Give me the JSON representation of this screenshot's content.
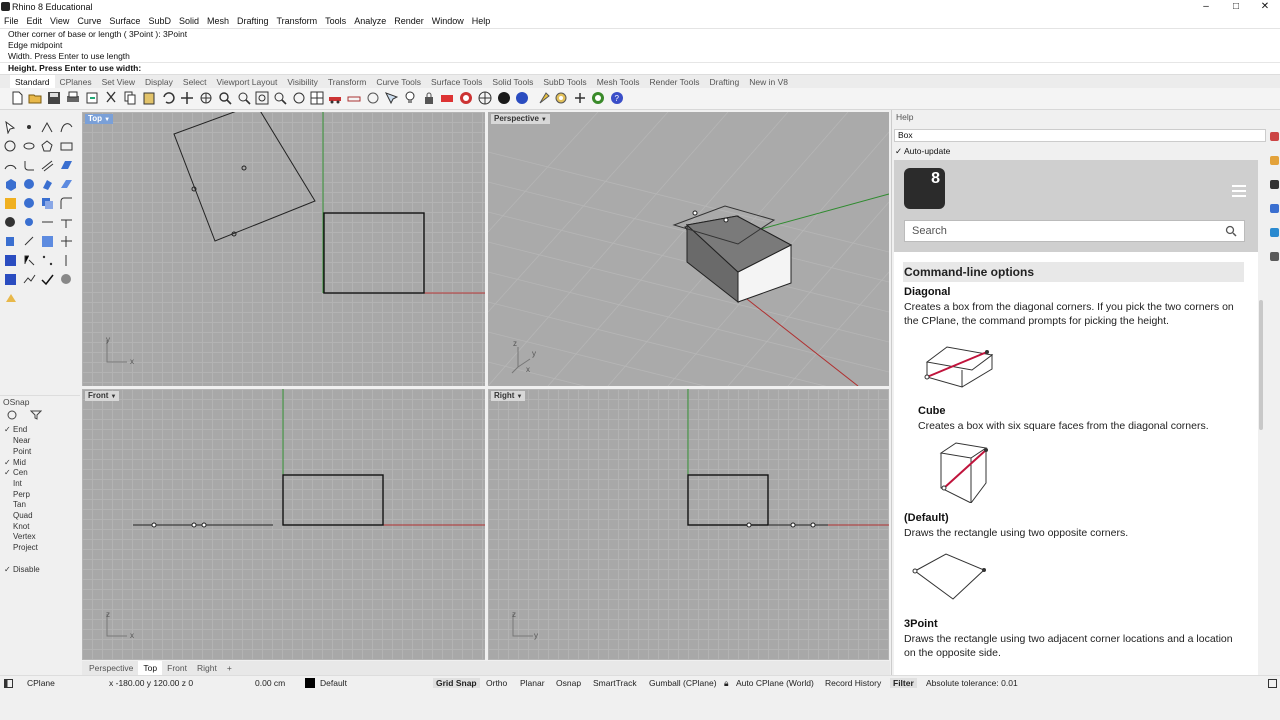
{
  "window": {
    "title": "Rhino 8 Educational",
    "controls": [
      "–",
      "□",
      "✕"
    ]
  },
  "menu": [
    "File",
    "Edit",
    "View",
    "Curve",
    "Surface",
    "SubD",
    "Solid",
    "Mesh",
    "Drafting",
    "Transform",
    "Tools",
    "Analyze",
    "Render",
    "Window",
    "Help"
  ],
  "command": {
    "history": [
      "Other corner of base or length ( 3Point ): 3Point",
      "Edge midpoint",
      "Width. Press Enter to use length"
    ],
    "prompt": "Height. Press Enter to use width:"
  },
  "toolbar_tabs": [
    "Standard",
    "CPlanes",
    "Set View",
    "Display",
    "Select",
    "Viewport Layout",
    "Visibility",
    "Transform",
    "Curve Tools",
    "Surface Tools",
    "Solid Tools",
    "SubD Tools",
    "Mesh Tools",
    "Render Tools",
    "Drafting",
    "New in V8"
  ],
  "active_toolbar_tab": "Standard",
  "viewports": {
    "top": {
      "label": "Top",
      "axis1": "x",
      "axis2": "y"
    },
    "perspective": {
      "label": "Perspective",
      "axis1": "x",
      "axis2": "y",
      "axis3": "z"
    },
    "front": {
      "label": "Front",
      "axis1": "x",
      "axis2": "z"
    },
    "right": {
      "label": "Right",
      "axis1": "y",
      "axis2": "z"
    }
  },
  "viewport_tabs": [
    "Perspective",
    "Top",
    "Front",
    "Right"
  ],
  "active_viewport_tab": "Top",
  "osnap": {
    "title": "OSnap",
    "items": [
      {
        "label": "End",
        "checked": true
      },
      {
        "label": "Near",
        "checked": false
      },
      {
        "label": "Point",
        "checked": false
      },
      {
        "label": "Mid",
        "checked": true
      },
      {
        "label": "Cen",
        "checked": true
      },
      {
        "label": "Int",
        "checked": false
      },
      {
        "label": "Perp",
        "checked": false
      },
      {
        "label": "Tan",
        "checked": false
      },
      {
        "label": "Quad",
        "checked": false
      },
      {
        "label": "Knot",
        "checked": false
      },
      {
        "label": "Vertex",
        "checked": false
      },
      {
        "label": "Project",
        "checked": false
      }
    ],
    "disable": {
      "label": "Disable",
      "checked": true
    }
  },
  "status": {
    "cplane": "CPlane",
    "coords": "x -180.00  y 120.00  z 0",
    "units": "0.00 cm",
    "layer": "Default",
    "layer_color": "#000000",
    "grid_snap": "Grid Snap",
    "ortho": "Ortho",
    "planar": "Planar",
    "osnap": "Osnap",
    "smarttrack": "SmartTrack",
    "gumball": "Gumball (CPlane)",
    "autocplane": "Auto CPlane (World)",
    "record_history": "Record History",
    "filter": "Filter",
    "tolerance": "Absolute tolerance: 0.01"
  },
  "help": {
    "panel_title": "Help",
    "topic": "Box",
    "auto_update": "Auto-update",
    "logo_text": "8",
    "search_placeholder": "Search",
    "section_title": "Command-line options",
    "options": [
      {
        "name": "Diagonal",
        "desc1": "Creates a box from the diagonal corners. If you pick the two corners on",
        "desc2": "the CPlane, the command prompts for picking the height."
      },
      {
        "name": "Cube",
        "desc1": "Creates a box with six square faces from the diagonal corners."
      },
      {
        "name": "(Default)",
        "desc1": "Draws the rectangle using two opposite corners."
      },
      {
        "name": "3Point",
        "desc1": "Draws the rectangle using two adjacent corner locations and a location",
        "desc2": "on the opposite side."
      }
    ]
  },
  "colors": {
    "accent": "#7aa0d8",
    "x_axis": "#b03030",
    "y_axis": "#2e8b2e",
    "help_diagram_red": "#c0143c"
  }
}
